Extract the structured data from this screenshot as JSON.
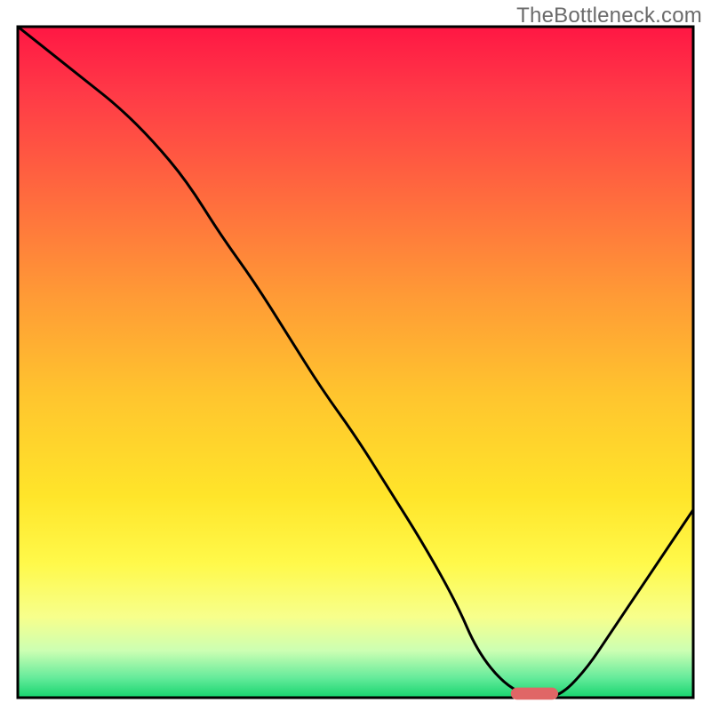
{
  "watermark": "TheBottleneck.com",
  "chart_data": {
    "type": "line",
    "title": "",
    "xlabel": "",
    "ylabel": "",
    "xlim": [
      0,
      100
    ],
    "ylim": [
      0,
      100
    ],
    "axes_visible": false,
    "grid": false,
    "background_gradient": {
      "type": "vertical",
      "stops": [
        {
          "offset": 0.0,
          "color": "#ff1744"
        },
        {
          "offset": 0.1,
          "color": "#ff3a47"
        },
        {
          "offset": 0.25,
          "color": "#ff6a3e"
        },
        {
          "offset": 0.4,
          "color": "#ff9a36"
        },
        {
          "offset": 0.55,
          "color": "#ffc52e"
        },
        {
          "offset": 0.7,
          "color": "#ffe52a"
        },
        {
          "offset": 0.8,
          "color": "#fff94a"
        },
        {
          "offset": 0.88,
          "color": "#f7ff8c"
        },
        {
          "offset": 0.93,
          "color": "#ccffb3"
        },
        {
          "offset": 0.97,
          "color": "#66eb9b"
        },
        {
          "offset": 1.0,
          "color": "#16d46e"
        }
      ]
    },
    "series": [
      {
        "name": "bottleneck-curve",
        "stroke": "#000000",
        "stroke_width": 3,
        "x": [
          0,
          5,
          10,
          15,
          20,
          25,
          30,
          35,
          40,
          45,
          50,
          55,
          60,
          65,
          68,
          72,
          76,
          80,
          84,
          88,
          92,
          96,
          100
        ],
        "y": [
          100,
          96,
          92,
          88,
          83,
          77,
          69,
          62,
          54,
          46,
          39,
          31,
          23,
          14,
          7,
          2,
          0,
          0,
          4,
          10,
          16,
          22,
          28
        ]
      }
    ],
    "marker": {
      "name": "optimum-marker",
      "color": "#e06666",
      "shape": "rounded-rect",
      "x_range": [
        73,
        80
      ],
      "y": 0.6,
      "height": 1.8
    }
  }
}
